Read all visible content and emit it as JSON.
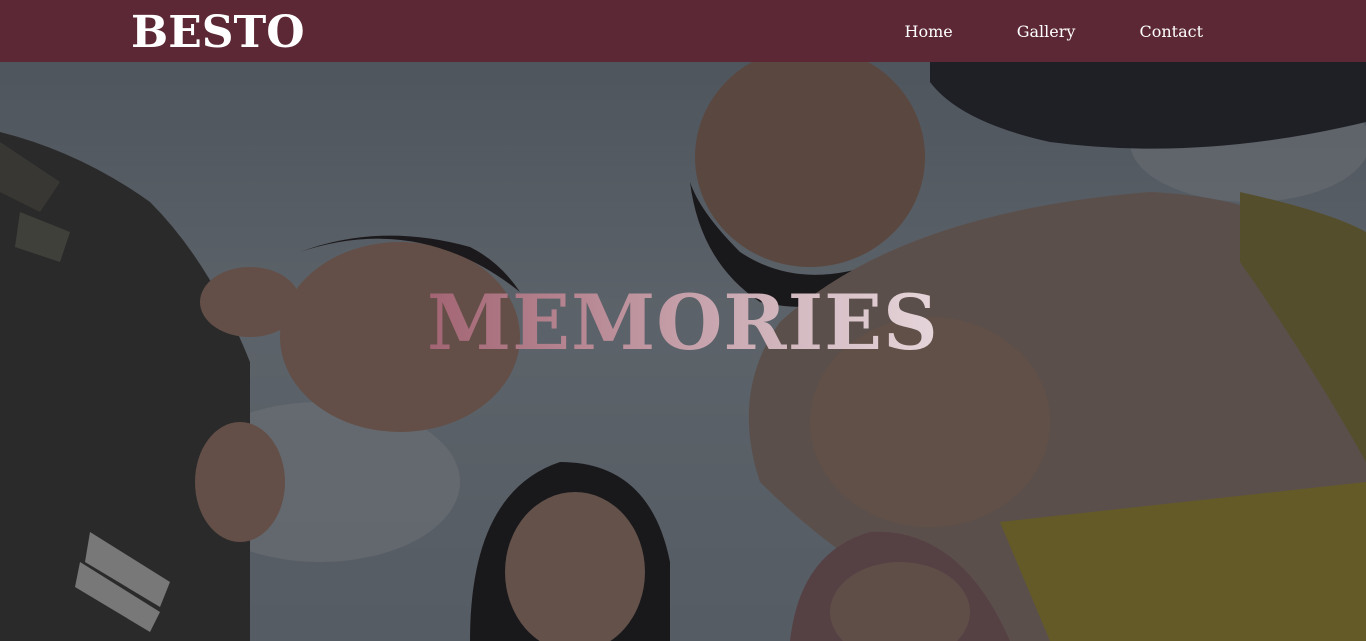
{
  "brand": {
    "name": "BESTO"
  },
  "nav": {
    "items": [
      {
        "label": "Home"
      },
      {
        "label": "Gallery"
      },
      {
        "label": "Contact"
      }
    ]
  },
  "hero": {
    "title": "MEMORIES",
    "image_alt": "group of friends looking down into camera",
    "overlay_color": "#1e1e22"
  },
  "colors": {
    "navbar": "#5c2835",
    "text": "#ffffff",
    "title_gradient_start": "#7a2a3a",
    "title_gradient_end": "#ffffff"
  }
}
